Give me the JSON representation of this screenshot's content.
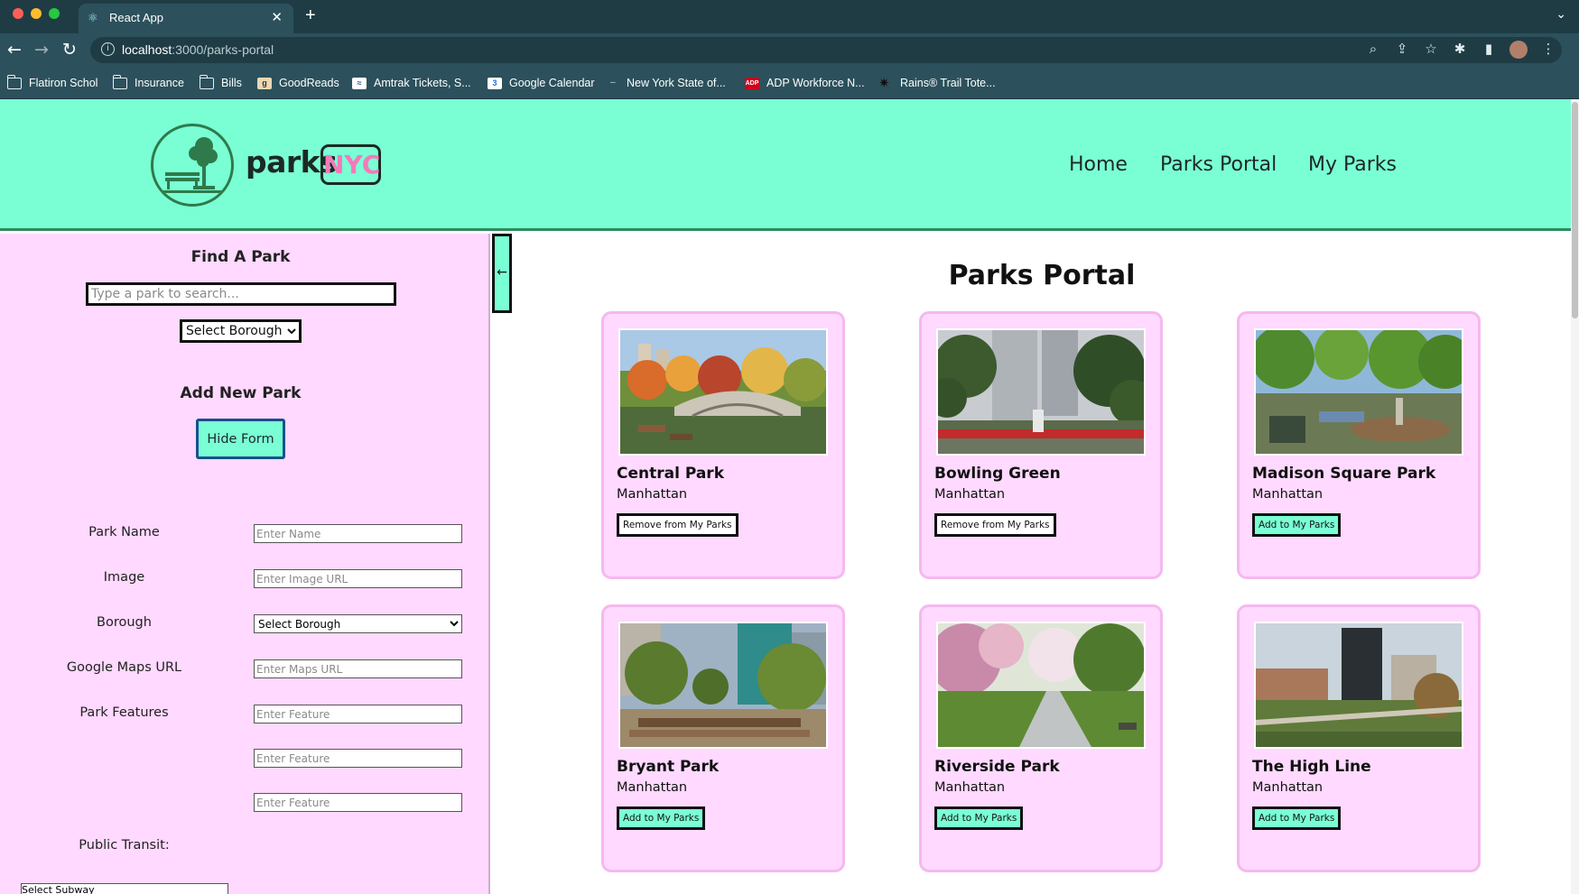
{
  "browser": {
    "tab_title": "React App",
    "url_host": "localhost",
    "url_path": ":3000/parks-portal",
    "bookmarks": [
      {
        "label": "Flatiron Schol",
        "icon": "folder-icon"
      },
      {
        "label": "Insurance",
        "icon": "folder-icon"
      },
      {
        "label": "Bills",
        "icon": "folder-icon"
      },
      {
        "label": "GoodReads",
        "icon": "goodreads-icon"
      },
      {
        "label": "Amtrak Tickets, S...",
        "icon": "amtrak-icon"
      },
      {
        "label": "Google Calendar",
        "icon": "calendar-icon"
      },
      {
        "label": "New York State of...",
        "icon": "nys-icon"
      },
      {
        "label": "ADP Workforce N...",
        "icon": "adp-icon"
      },
      {
        "label": "Rains® Trail Tote...",
        "icon": "rains-icon"
      }
    ]
  },
  "header": {
    "logo_text": "parks",
    "logo_badge": "NYC",
    "nav": [
      "Home",
      "Parks Portal",
      "My Parks"
    ]
  },
  "sidebar": {
    "find_title": "Find A Park",
    "search_placeholder": "Type a park to search...",
    "borough_select": "Select Borough",
    "add_title": "Add New Park",
    "hide_form_label": "Hide Form",
    "form": {
      "park_name_label": "Park Name",
      "park_name_placeholder": "Enter Name",
      "image_label": "Image",
      "image_placeholder": "Enter Image URL",
      "borough_label": "Borough",
      "borough_select": "Select Borough",
      "maps_label": "Google Maps URL",
      "maps_placeholder": "Enter Maps URL",
      "features_label": "Park Features",
      "feature_placeholder": "Enter Feature",
      "transit_label": "Public Transit:",
      "subway_select": "Select Subway"
    },
    "collapse_label": "←"
  },
  "main": {
    "title": "Parks Portal",
    "parks": [
      {
        "name": "Central Park",
        "borough": "Manhattan",
        "button": "Remove from My Parks",
        "in_my_parks": true
      },
      {
        "name": "Bowling Green",
        "borough": "Manhattan",
        "button": "Remove from My Parks",
        "in_my_parks": true
      },
      {
        "name": "Madison Square Park",
        "borough": "Manhattan",
        "button": "Add to My Parks",
        "in_my_parks": false
      },
      {
        "name": "Bryant Park",
        "borough": "Manhattan",
        "button": "Add to My Parks",
        "in_my_parks": false
      },
      {
        "name": "Riverside Park",
        "borough": "Manhattan",
        "button": "Add to My Parks",
        "in_my_parks": false
      },
      {
        "name": "The High Line",
        "borough": "Manhattan",
        "button": "Add to My Parks",
        "in_my_parks": false
      }
    ]
  },
  "colors": {
    "header_bg": "#7affd5",
    "sidebar_bg": "#ffd9ff",
    "card_border": "#f5b8ef",
    "badge_pink": "#f47ab8",
    "browser_chrome": "#2c515c"
  }
}
